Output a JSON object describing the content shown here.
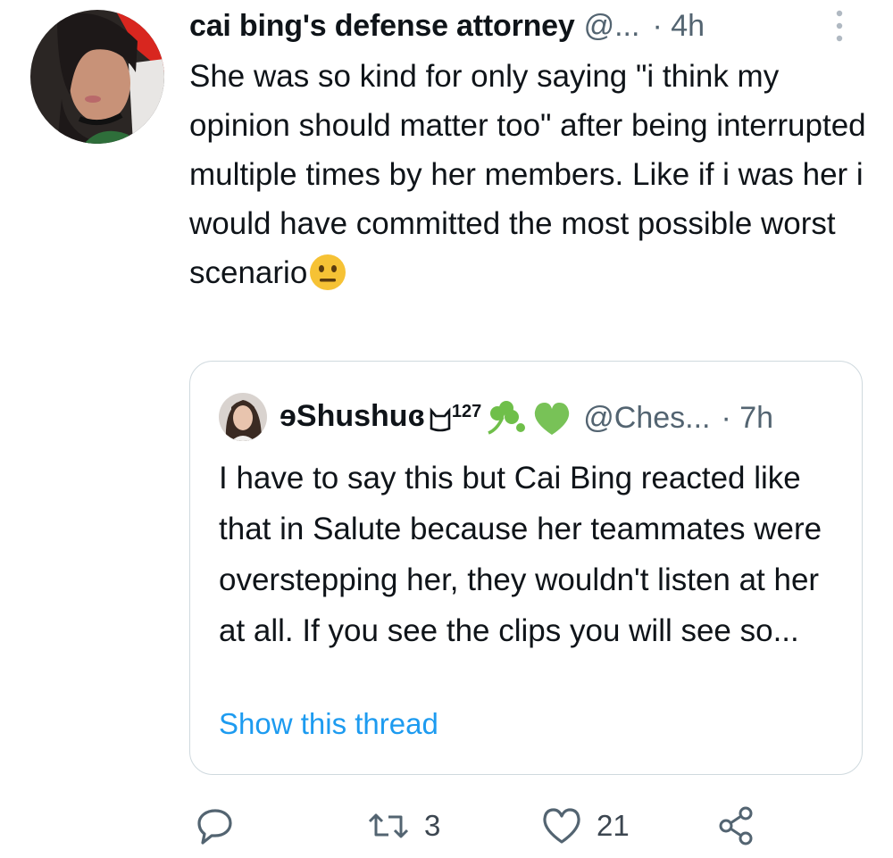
{
  "tweet": {
    "author_name": "cai bing's defense attorney",
    "handle": "@...",
    "separator": "·",
    "time": "4h",
    "text_main": "She was so kind for only saying \"i think my opinion should matter too\" after being interrupted multiple times by her members. Like if i was her i would have committed the most possible worst scenario",
    "emoji": "neutral-face-emoji"
  },
  "quoted": {
    "name_prefix": "ɘShushuɞ",
    "name_sup": "127",
    "handle": "@Ches...",
    "separator": "·",
    "time": "7h",
    "text": "I have to say this but Cai Bing reacted like that in Salute because her teammates were overstepping her, they wouldn't listen at her at all. If you see the clips you will see so...",
    "show_thread_label": "Show this thread",
    "decorations": [
      "cat-face-icon",
      "shamrock-icon",
      "green-heart-icon"
    ]
  },
  "actions": {
    "reply_icon": "reply-icon",
    "retweet_count": "3",
    "like_count": "21",
    "share_icon": "share-icon"
  },
  "colors": {
    "text": "#0f1419",
    "muted": "#536471",
    "link": "#1d9bf0",
    "border": "#cfd9de",
    "shamrock": "#6fbf4a",
    "heart": "#78c257"
  }
}
